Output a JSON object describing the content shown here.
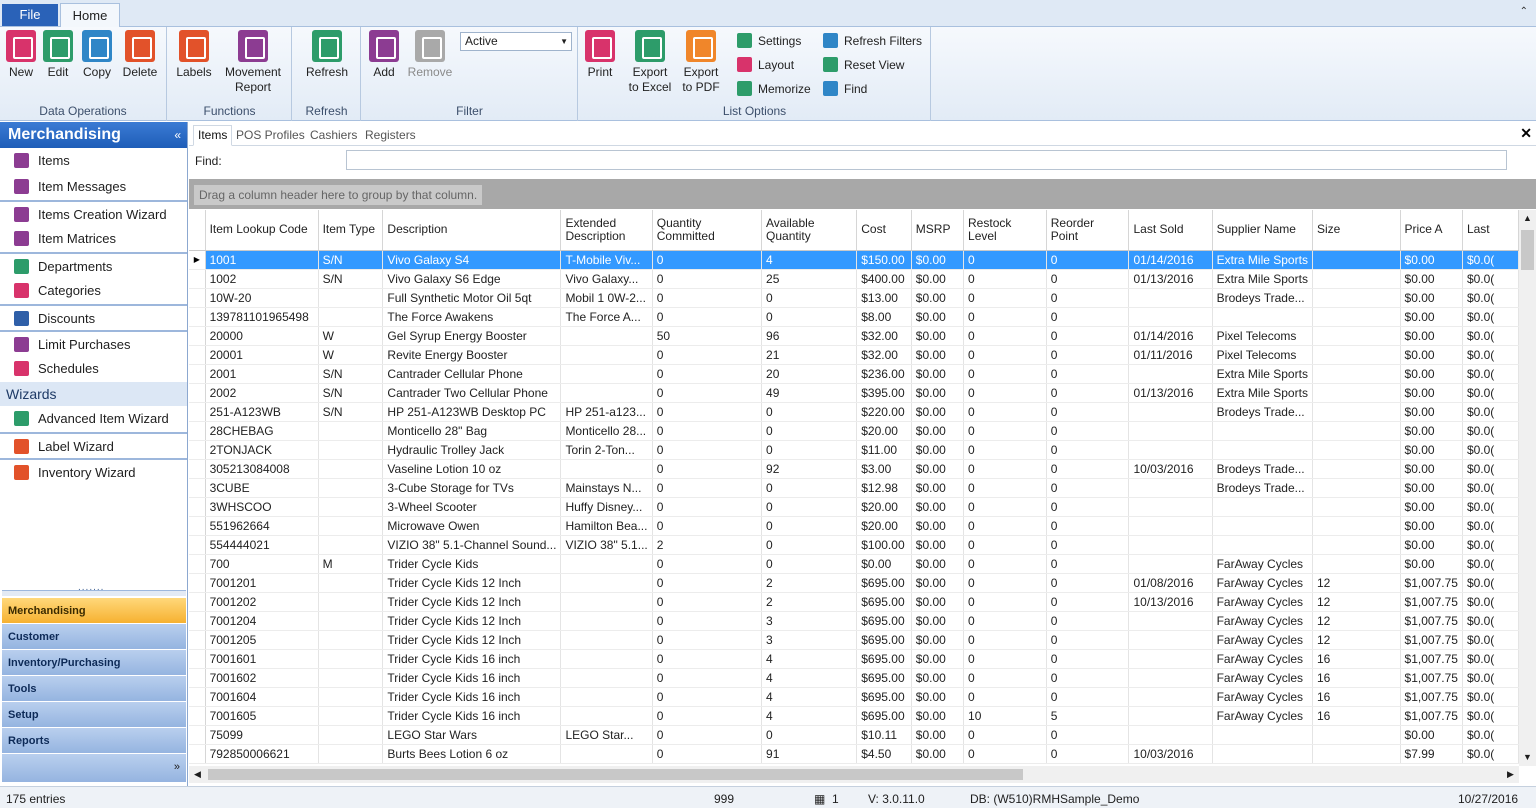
{
  "tabs": {
    "file": "File",
    "home": "Home"
  },
  "ribbon": {
    "groups": {
      "data_ops": "Data Operations",
      "functions": "Functions",
      "refresh": "Refresh",
      "filter": "Filter",
      "list_options": "List Options"
    },
    "buttons": {
      "new": "New",
      "edit": "Edit",
      "copy": "Copy",
      "delete": "Delete",
      "labels": "Labels",
      "movement_1": "Movement",
      "movement_2": "Report",
      "refresh": "Refresh",
      "add": "Add",
      "remove": "Remove",
      "print": "Print",
      "export_excel_1": "Export",
      "export_excel_2": "to Excel",
      "export_pdf_1": "Export",
      "export_pdf_2": "to PDF"
    },
    "filter_select": "Active",
    "small": {
      "settings": "Settings",
      "layout": "Layout",
      "memorize": "Memorize",
      "refresh_filters": "Refresh Filters",
      "reset_view": "Reset View",
      "find": "Find"
    }
  },
  "nav": {
    "title": "Merchandising",
    "items": [
      "Items",
      "Item Messages",
      "Items Creation Wizard",
      "Item Matrices",
      "Departments",
      "Categories",
      "Discounts",
      "Limit Purchases",
      "Schedules"
    ],
    "wizards_header": "Wizards",
    "wizards": [
      "Advanced Item Wizard",
      "Label Wizard",
      "Inventory Wizard"
    ],
    "modules": [
      "Merchandising",
      "Customer",
      "Inventory/Purchasing",
      "Tools",
      "Setup",
      "Reports"
    ]
  },
  "content": {
    "subtabs": [
      "Items",
      "POS Profiles",
      "Cashiers",
      "Registers"
    ],
    "find_label": "Find:",
    "group_hint": "Drag a column header here to group by that column.",
    "columns": [
      "Item Lookup Code",
      "Item Type",
      "Description",
      "Extended Description",
      "Quantity Committed",
      "Available Quantity",
      "Cost",
      "MSRP",
      "Restock Level",
      "Reorder Point",
      "Last Sold",
      "Supplier Name",
      "Size",
      "Price A",
      "Last"
    ],
    "rows": [
      [
        "1001",
        "S/N",
        "Vivo Galaxy S4",
        "T-Mobile Viv...",
        "0",
        "4",
        "$150.00",
        "$0.00",
        "0",
        "0",
        "01/14/2016",
        "Extra Mile Sports",
        "",
        "$0.00",
        "$0.0("
      ],
      [
        "1002",
        "S/N",
        "Vivo Galaxy S6 Edge",
        "Vivo Galaxy...",
        "0",
        "25",
        "$400.00",
        "$0.00",
        "0",
        "0",
        "01/13/2016",
        "Extra Mile Sports",
        "",
        "$0.00",
        "$0.0("
      ],
      [
        "10W-20",
        "",
        "Full Synthetic Motor Oil 5qt",
        "Mobil 1 0W-2...",
        "0",
        "0",
        "$13.00",
        "$0.00",
        "0",
        "0",
        "",
        "Brodeys Trade...",
        "",
        "$0.00",
        "$0.0("
      ],
      [
        "139781101965498",
        "",
        "The Force Awakens",
        "The Force A...",
        "0",
        "0",
        "$8.00",
        "$0.00",
        "0",
        "0",
        "",
        "",
        "",
        "$0.00",
        "$0.0("
      ],
      [
        "20000",
        "W",
        "Gel Syrup Energy Booster",
        "",
        "50",
        "96",
        "$32.00",
        "$0.00",
        "0",
        "0",
        "01/14/2016",
        "Pixel Telecoms",
        "",
        "$0.00",
        "$0.0("
      ],
      [
        "20001",
        "W",
        "Revite Energy Booster",
        "",
        "0",
        "21",
        "$32.00",
        "$0.00",
        "0",
        "0",
        "01/11/2016",
        "Pixel Telecoms",
        "",
        "$0.00",
        "$0.0("
      ],
      [
        "2001",
        "S/N",
        "Cantrader Cellular Phone",
        "",
        "0",
        "20",
        "$236.00",
        "$0.00",
        "0",
        "0",
        "",
        "Extra Mile Sports",
        "",
        "$0.00",
        "$0.0("
      ],
      [
        "2002",
        "S/N",
        "Cantrader Two Cellular Phone",
        "",
        "0",
        "49",
        "$395.00",
        "$0.00",
        "0",
        "0",
        "01/13/2016",
        "Extra Mile Sports",
        "",
        "$0.00",
        "$0.0("
      ],
      [
        "251-A123WB",
        "S/N",
        "HP 251-A123WB Desktop PC",
        "HP 251-a123...",
        "0",
        "0",
        "$220.00",
        "$0.00",
        "0",
        "0",
        "",
        "Brodeys Trade...",
        "",
        "$0.00",
        "$0.0("
      ],
      [
        "28CHEBAG",
        "",
        "Monticello 28\" Bag",
        "Monticello 28...",
        "0",
        "0",
        "$20.00",
        "$0.00",
        "0",
        "0",
        "",
        "",
        "",
        "$0.00",
        "$0.0("
      ],
      [
        "2TONJACK",
        "",
        "Hydraulic Trolley Jack",
        "Torin 2-Ton...",
        "0",
        "0",
        "$11.00",
        "$0.00",
        "0",
        "0",
        "",
        "",
        "",
        "$0.00",
        "$0.0("
      ],
      [
        "305213084008",
        "",
        "Vaseline Lotion 10 oz",
        "",
        "0",
        "92",
        "$3.00",
        "$0.00",
        "0",
        "0",
        "10/03/2016",
        "Brodeys Trade...",
        "",
        "$0.00",
        "$0.0("
      ],
      [
        "3CUBE",
        "",
        "3-Cube Storage for TVs",
        "Mainstays N...",
        "0",
        "0",
        "$12.98",
        "$0.00",
        "0",
        "0",
        "",
        "Brodeys Trade...",
        "",
        "$0.00",
        "$0.0("
      ],
      [
        "3WHSCOO",
        "",
        "3-Wheel Scooter",
        "Huffy Disney...",
        "0",
        "0",
        "$20.00",
        "$0.00",
        "0",
        "0",
        "",
        "",
        "",
        "$0.00",
        "$0.0("
      ],
      [
        "551962664",
        "",
        "Microwave Owen",
        "Hamilton Bea...",
        "0",
        "0",
        "$20.00",
        "$0.00",
        "0",
        "0",
        "",
        "",
        "",
        "$0.00",
        "$0.0("
      ],
      [
        "554444021",
        "",
        "VIZIO 38\" 5.1-Channel Sound...",
        "VIZIO 38\" 5.1...",
        "2",
        "0",
        "$100.00",
        "$0.00",
        "0",
        "0",
        "",
        "",
        "",
        "$0.00",
        "$0.0("
      ],
      [
        "700",
        "M",
        "Trider Cycle Kids",
        "",
        "0",
        "0",
        "$0.00",
        "$0.00",
        "0",
        "0",
        "",
        "FarAway Cycles",
        "",
        "$0.00",
        "$0.0("
      ],
      [
        "7001201",
        "",
        "Trider Cycle Kids 12 Inch",
        "",
        "0",
        "2",
        "$695.00",
        "$0.00",
        "0",
        "0",
        "01/08/2016",
        "FarAway Cycles",
        "12",
        "$1,007.75",
        "$0.0("
      ],
      [
        "7001202",
        "",
        "Trider Cycle Kids 12 Inch",
        "",
        "0",
        "2",
        "$695.00",
        "$0.00",
        "0",
        "0",
        "10/13/2016",
        "FarAway Cycles",
        "12",
        "$1,007.75",
        "$0.0("
      ],
      [
        "7001204",
        "",
        "Trider Cycle Kids 12 Inch",
        "",
        "0",
        "3",
        "$695.00",
        "$0.00",
        "0",
        "0",
        "",
        "FarAway Cycles",
        "12",
        "$1,007.75",
        "$0.0("
      ],
      [
        "7001205",
        "",
        "Trider Cycle Kids 12 Inch",
        "",
        "0",
        "3",
        "$695.00",
        "$0.00",
        "0",
        "0",
        "",
        "FarAway Cycles",
        "12",
        "$1,007.75",
        "$0.0("
      ],
      [
        "7001601",
        "",
        "Trider Cycle Kids 16 inch",
        "",
        "0",
        "4",
        "$695.00",
        "$0.00",
        "0",
        "0",
        "",
        "FarAway Cycles",
        "16",
        "$1,007.75",
        "$0.0("
      ],
      [
        "7001602",
        "",
        "Trider Cycle Kids 16 inch",
        "",
        "0",
        "4",
        "$695.00",
        "$0.00",
        "0",
        "0",
        "",
        "FarAway Cycles",
        "16",
        "$1,007.75",
        "$0.0("
      ],
      [
        "7001604",
        "",
        "Trider Cycle Kids 16 inch",
        "",
        "0",
        "4",
        "$695.00",
        "$0.00",
        "0",
        "0",
        "",
        "FarAway Cycles",
        "16",
        "$1,007.75",
        "$0.0("
      ],
      [
        "7001605",
        "",
        "Trider Cycle Kids 16 inch",
        "",
        "0",
        "4",
        "$695.00",
        "$0.00",
        "10",
        "5",
        "",
        "FarAway Cycles",
        "16",
        "$1,007.75",
        "$0.0("
      ],
      [
        "75099",
        "",
        "LEGO Star Wars",
        "LEGO Star...",
        "0",
        "0",
        "$10.11",
        "$0.00",
        "0",
        "0",
        "",
        "",
        "",
        "$0.00",
        "$0.0("
      ],
      [
        "792850006621",
        "",
        "Burts Bees Lotion 6 oz",
        "",
        "0",
        "91",
        "$4.50",
        "$0.00",
        "0",
        "0",
        "10/03/2016",
        "",
        "",
        "$7.99",
        "$0.0("
      ]
    ]
  },
  "status": {
    "entries": "175 entries",
    "count": "999",
    "register": "1",
    "version": "V: 3.0.11.0",
    "db": "DB: (W510)RMHSample_Demo",
    "date": "10/27/2016"
  },
  "colors": {
    "accent": "#2a62b8",
    "selection": "#3399ff",
    "active_module": "#f6b131"
  }
}
